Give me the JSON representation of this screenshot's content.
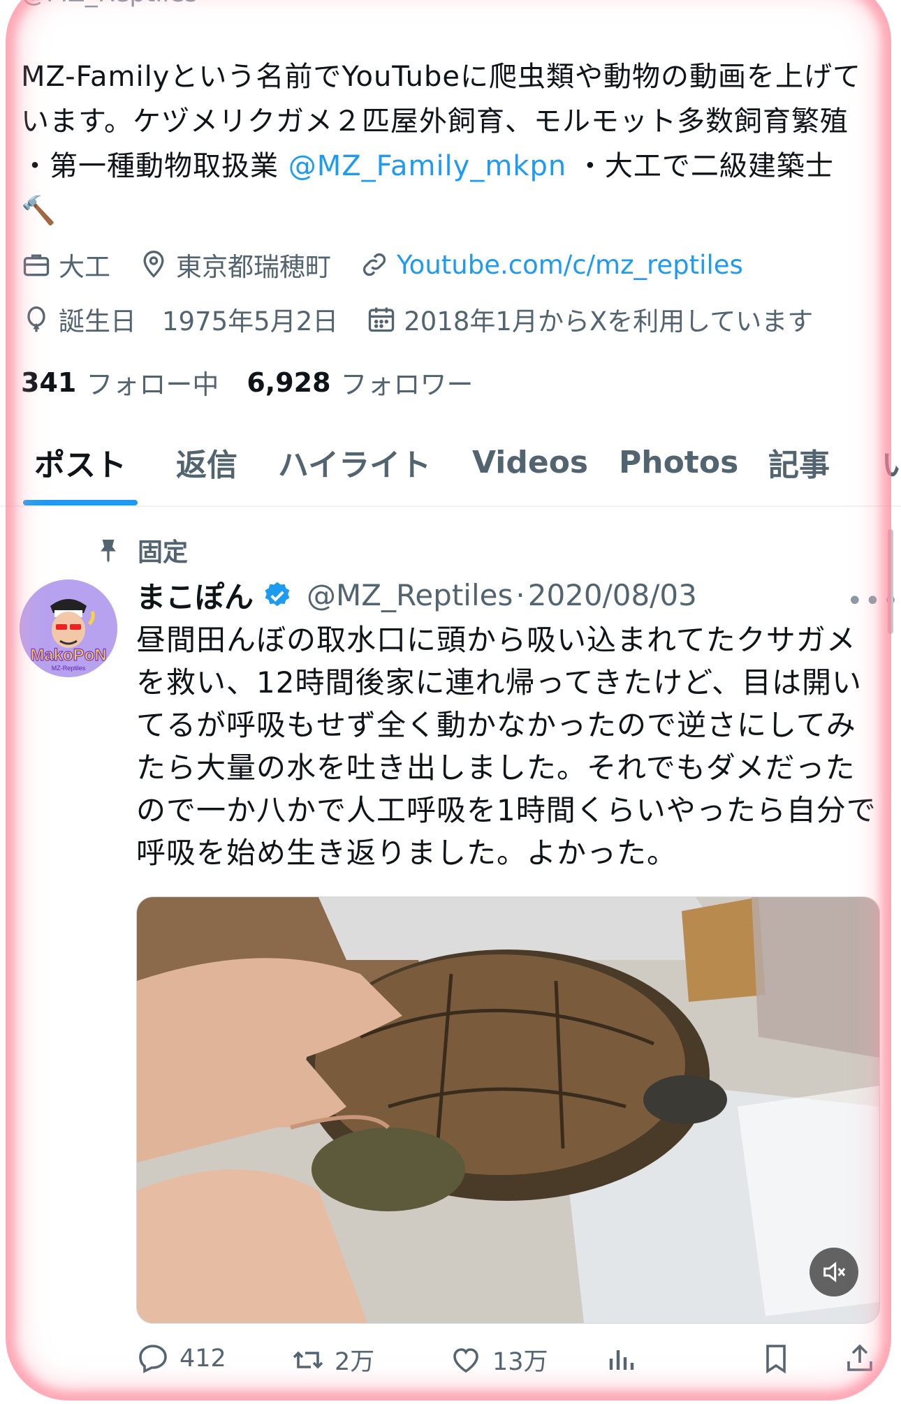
{
  "profile": {
    "handle_top": "@MZ_Reptiles",
    "bio_text_1": "MZ-Familyという名前でYouTubeに爬虫類や動物の動画を上げています。ケヅメリクガメ２匹屋外飼育、モルモット多数飼育繁殖 ・第一種動物取扱業 ",
    "bio_mention": "@MZ_Family_mkpn",
    "bio_text_2": " ・大工で二級建築士",
    "bio_emoji": "🔨",
    "occupation": "大工",
    "location": "東京都瑞穂町",
    "website": "Youtube.com/c/mz_reptiles",
    "birthday": "誕生日　1975年5月2日",
    "joined": "2018年1月からXを利用しています",
    "following_count": "341",
    "following_label": "フォロー中",
    "followers_count": "6,928",
    "followers_label": "フォロワー"
  },
  "tabs": [
    "ポスト",
    "返信",
    "ハイライト",
    "Videos",
    "Photos",
    "記事",
    "い"
  ],
  "active_tab": "ポスト",
  "pinned_tweet": {
    "pinned_label": "固定",
    "display_name": "まこぽん",
    "handle": "@MZ_Reptiles",
    "separator": "·",
    "date": "2020/08/03",
    "avatar_text": "MakoPoN",
    "avatar_subtext": "MZ-Reptiles",
    "text": "昼間田んぼの取水口に頭から吸い込まれてたクサガメを救い、12時間後家に連れ帰ってきたけど、目は開いてるが呼吸もせず全く動かなかったので逆さにしてみたら大量の水を吐き出しました。それでもダメだったので一か八かで人工呼吸を1時間くらいやったら自分で呼吸を始め生き返りました。よかった。",
    "more_glyph": "•••",
    "stats": {
      "replies": "412",
      "retweets": "2万",
      "likes": "13万"
    }
  },
  "colors": {
    "accent": "#1d9bf0",
    "secondary_text": "#536471",
    "primary_text": "#0f1419",
    "glow": "#ff7a8c"
  },
  "icons": [
    "briefcase-icon",
    "location-pin-icon",
    "link-icon",
    "balloon-icon",
    "calendar-icon",
    "pin-icon",
    "verified-badge-icon",
    "more-icon",
    "reply-icon",
    "retweet-icon",
    "like-icon",
    "views-icon",
    "bookmark-icon",
    "share-icon",
    "mute-icon"
  ]
}
